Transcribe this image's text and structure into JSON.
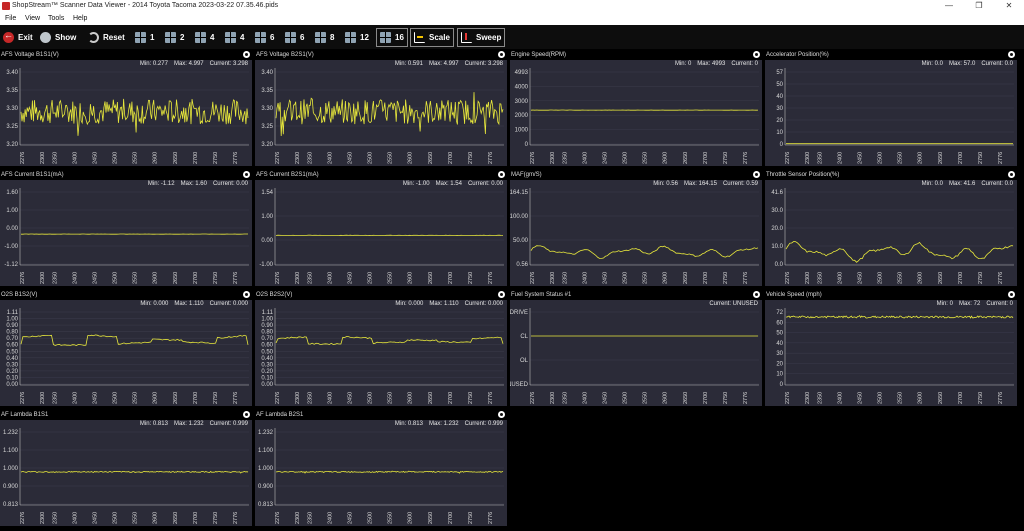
{
  "window": {
    "title": "ShopStream™ Scanner Data Viewer - 2014 Toyota Tacoma 2023-03-22 07.35.46.pids",
    "minimize": "—",
    "maximize": "❐",
    "close": "✕"
  },
  "menu": [
    "File",
    "View",
    "Tools",
    "Help"
  ],
  "toolbar": {
    "exit": "Exit",
    "show": "Show",
    "reset": "Reset",
    "layouts": [
      "1",
      "2",
      "4",
      "4",
      "6",
      "6",
      "8",
      "12",
      "16"
    ],
    "scale": "Scale",
    "sweep": "Sweep"
  },
  "colors": {
    "trace": "#e8e83c",
    "panel_bg": "#2b2b38",
    "grid": "#3c3c4c"
  },
  "x_ticks": [
    "2276",
    "2300",
    "2350",
    "2400",
    "2450",
    "2500",
    "2550",
    "2600",
    "2650",
    "2700",
    "2750",
    "2776"
  ],
  "panels": [
    {
      "title": "AFS Voltage B1S1(V)",
      "min": "Min: 0.277",
      "max": "Max: 4.997",
      "current": "Current: 3.298",
      "chart_data": {
        "type": "line",
        "yticks": [
          "3.40",
          "3.35",
          "3.30",
          "3.25",
          "3.20"
        ],
        "yrange": [
          3.2,
          3.4
        ],
        "profile": "noisy",
        "base": 3.29,
        "amp": 0.035
      }
    },
    {
      "title": "AFS Voltage B2S1(V)",
      "min": "Min: 0.591",
      "max": "Max: 4.997",
      "current": "Current: 3.298",
      "chart_data": {
        "type": "line",
        "yticks": [
          "3.40",
          "3.35",
          "3.30",
          "3.25",
          "3.20"
        ],
        "yrange": [
          3.2,
          3.4
        ],
        "profile": "noisy",
        "base": 3.29,
        "amp": 0.035
      }
    },
    {
      "title": "Engine Speed(RPM)",
      "min": "Min: 0",
      "max": "Max: 4993",
      "current": "Current: 0",
      "chart_data": {
        "type": "line",
        "yticks": [
          "4993",
          "4000",
          "3000",
          "2000",
          "1000",
          "0"
        ],
        "yrange": [
          0,
          4993
        ],
        "profile": "flat",
        "base": 2350,
        "amp": 15
      }
    },
    {
      "title": "Accelerator Position(%)",
      "min": "Min: 0.0",
      "max": "Max: 57.0",
      "current": "Current: 0.0",
      "chart_data": {
        "type": "line",
        "yticks": [
          "57",
          "50",
          "40",
          "30",
          "20",
          "10",
          "0"
        ],
        "yrange": [
          0,
          57
        ],
        "profile": "flat",
        "base": 0.2,
        "amp": 0
      }
    },
    {
      "title": "AFS Current B1S1(mA)",
      "min": "Min: -1.12",
      "max": "Max: 1.60",
      "current": "Current: 0.00",
      "chart_data": {
        "type": "line",
        "yticks": [
          "1.60",
          "1.00",
          "0.00",
          "-1.00",
          "-1.12"
        ],
        "yrange": [
          -1.12,
          1.6
        ],
        "profile": "flat",
        "base": 0.01,
        "amp": 0.01
      }
    },
    {
      "title": "AFS Current B2S1(mA)",
      "min": "Min: -1.00",
      "max": "Max: 1.54",
      "current": "Current: 0.00",
      "chart_data": {
        "type": "line",
        "yticks": [
          "1.54",
          "1.00",
          "0.00",
          "-1.00"
        ],
        "yrange": [
          -1.0,
          1.54
        ],
        "profile": "flat",
        "base": 0.01,
        "amp": 0.01
      }
    },
    {
      "title": "MAF(gm/S)",
      "min": "Min: 0.56",
      "max": "Max: 164.15",
      "current": "Current: 0.59",
      "chart_data": {
        "type": "line",
        "yticks": [
          "164.15",
          "100.00",
          "50.00",
          "0.56"
        ],
        "yrange": [
          0.56,
          164.15
        ],
        "profile": "wavy",
        "base": 28,
        "amp": 10
      }
    },
    {
      "title": "Throttle Sensor Position(%)",
      "min": "Min: 0.0",
      "max": "Max: 41.6",
      "current": "Current: 0.0",
      "chart_data": {
        "type": "line",
        "yticks": [
          "41.6",
          "30.0",
          "20.0",
          "10.0",
          "0.0"
        ],
        "yrange": [
          0,
          41.6
        ],
        "profile": "wavy",
        "base": 7,
        "amp": 4
      }
    },
    {
      "title": "O2S B1S2(V)",
      "min": "Min: 0.000",
      "max": "Max: 1.110",
      "current": "Current: 0.000",
      "chart_data": {
        "type": "line",
        "yticks": [
          "1.11",
          "1.00",
          "0.90",
          "0.80",
          "0.70",
          "0.60",
          "0.50",
          "0.40",
          "0.30",
          "0.20",
          "0.10",
          "0.00"
        ],
        "yrange": [
          0,
          1.11
        ],
        "profile": "o2",
        "base": 0.66,
        "amp": 0.1
      }
    },
    {
      "title": "O2S B2S2(V)",
      "min": "Min: 0.000",
      "max": "Max: 1.110",
      "current": "Current: 0.000",
      "chart_data": {
        "type": "line",
        "yticks": [
          "1.11",
          "1.00",
          "0.90",
          "0.80",
          "0.70",
          "0.60",
          "0.50",
          "0.40",
          "0.30",
          "0.20",
          "0.10",
          "0.00"
        ],
        "yrange": [
          0,
          1.11
        ],
        "profile": "o2",
        "base": 0.66,
        "amp": 0.07
      }
    },
    {
      "title": "Fuel System Status #1",
      "min": "",
      "max": "",
      "current": "Current: UNUSED",
      "chart_data": {
        "type": "line",
        "yticks": [
          "OLDRIVE",
          "CL",
          "OL",
          "UNUSED"
        ],
        "yrange": [
          0,
          3
        ],
        "profile": "flat",
        "base": 2,
        "amp": 0
      }
    },
    {
      "title": "Vehicle Speed (mph)",
      "min": "Min: 0",
      "max": "Max: 72",
      "current": "Current: 0",
      "chart_data": {
        "type": "line",
        "yticks": [
          "72",
          "60",
          "50",
          "40",
          "30",
          "20",
          "10",
          "0"
        ],
        "yrange": [
          0,
          72
        ],
        "profile": "noisy",
        "base": 67,
        "amp": 1
      }
    },
    {
      "title": "AF Lambda B1S1",
      "min": "Min: 0.813",
      "max": "Max: 1.232",
      "current": "Current: 0.999",
      "chart_data": {
        "type": "line",
        "yticks": [
          "1.232",
          "1.100",
          "1.000",
          "0.900",
          "0.813"
        ],
        "yrange": [
          0.813,
          1.232
        ],
        "profile": "noisy",
        "base": 1.0,
        "amp": 0.003
      }
    },
    {
      "title": "AF Lambda B2S1",
      "min": "Min: 0.813",
      "max": "Max: 1.232",
      "current": "Current: 0.999",
      "chart_data": {
        "type": "line",
        "yticks": [
          "1.232",
          "1.100",
          "1.000",
          "0.900",
          "0.813"
        ],
        "yrange": [
          0.813,
          1.232
        ],
        "profile": "noisy",
        "base": 1.0,
        "amp": 0.003
      }
    }
  ]
}
